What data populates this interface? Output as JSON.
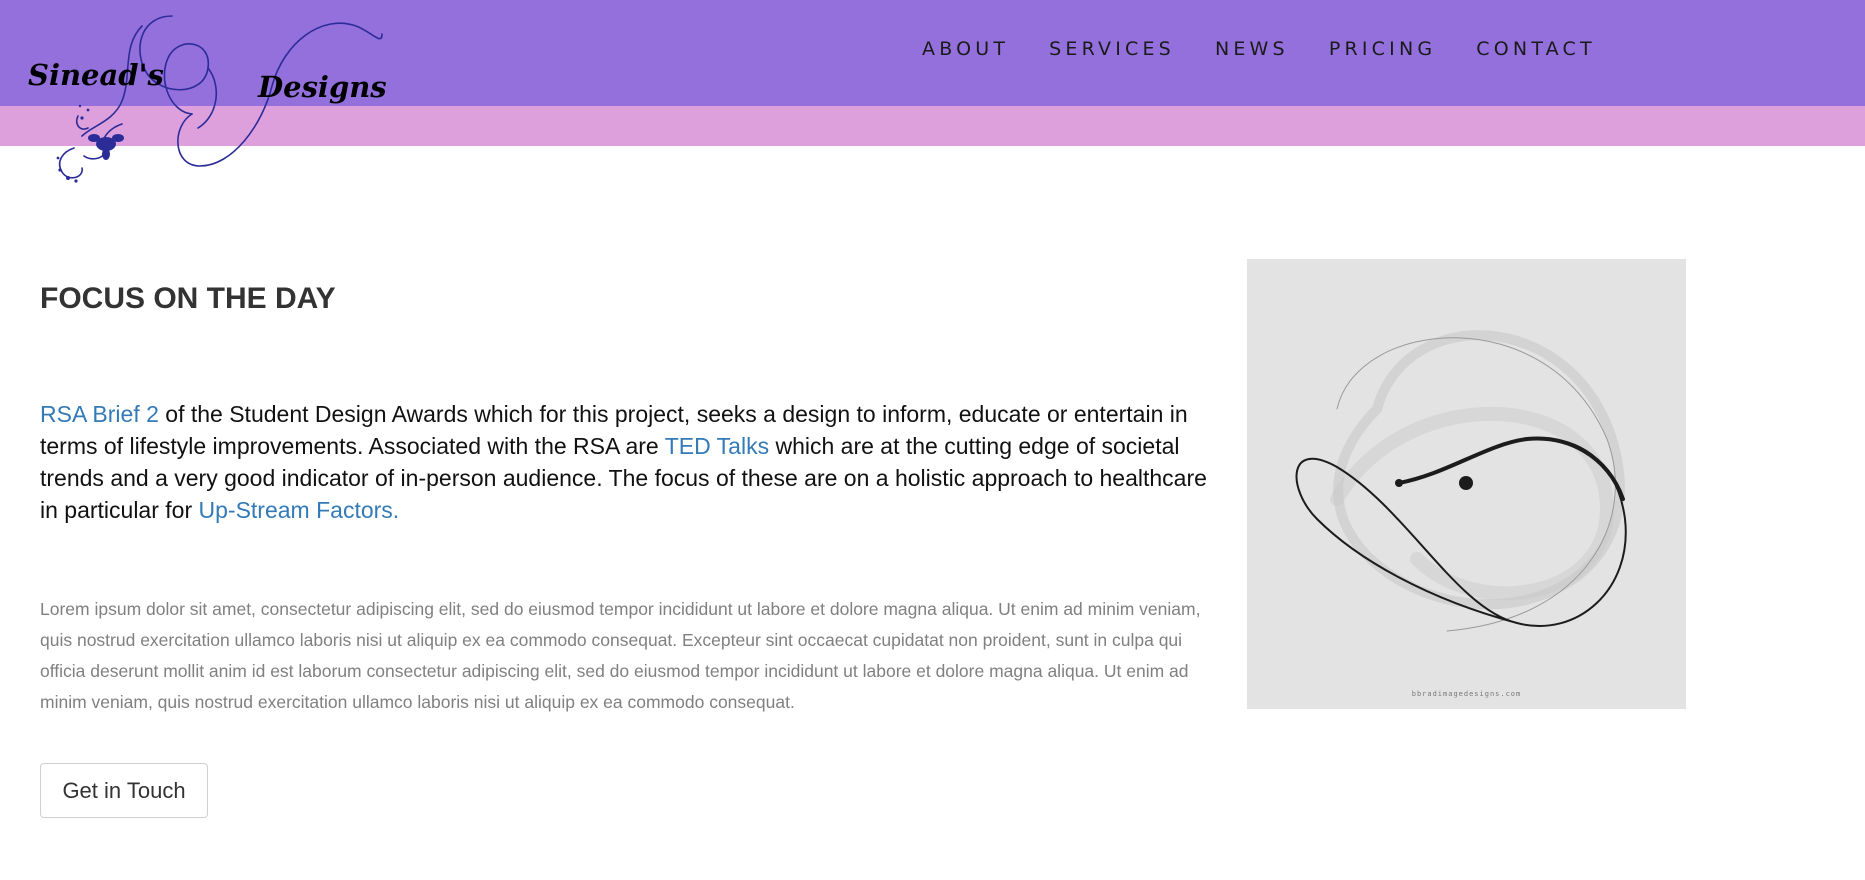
{
  "brand": {
    "name_part1": "Sinead's",
    "name_part2": "Designs",
    "colors": {
      "header": "#9370db",
      "band": "#dda0dd",
      "logo_ink": "#2c2c99"
    }
  },
  "nav": {
    "items": [
      {
        "label": "ABOUT"
      },
      {
        "label": "SERVICES"
      },
      {
        "label": "NEWS"
      },
      {
        "label": "PRICING"
      },
      {
        "label": "CONTACT"
      }
    ]
  },
  "main": {
    "heading": "FOCUS ON THE DAY",
    "intro": {
      "link1": "RSA Brief 2",
      "text1": " of the Student Design Awards which for this project, seeks a design to inform, educate or entertain in terms of lifestyle improvements. Associated with the RSA are ",
      "link2": "TED Talks",
      "text2": " which are at the cutting edge of societal trends and a very good indicator of in-person audience. The focus of these are on a holistic approach to healthcare in particular for ",
      "link3": "Up-Stream Factors."
    },
    "lorem": "Lorem ipsum dolor sit amet, consectetur adipiscing elit, sed do eiusmod tempor incididunt ut labore et dolore magna aliqua. Ut enim ad minim veniam, quis nostrud exercitation ullamco laboris nisi ut aliquip ex ea commodo consequat. Excepteur sint occaecat cupidatat non proident, sunt in culpa qui officia deserunt mollit anim id est laborum consectetur adipiscing elit, sed do eiusmod tempor incididunt ut labore et dolore magna aliqua. Ut enim ad minim veniam, quis nostrud exercitation ullamco laboris nisi ut aliquip ex ea commodo consequat.",
    "cta_label": "Get in Touch",
    "image": {
      "caption": "bbradimagedesigns.com",
      "colors": {
        "background": "#e3e3e3",
        "ink": "#1a1a1a"
      }
    }
  }
}
